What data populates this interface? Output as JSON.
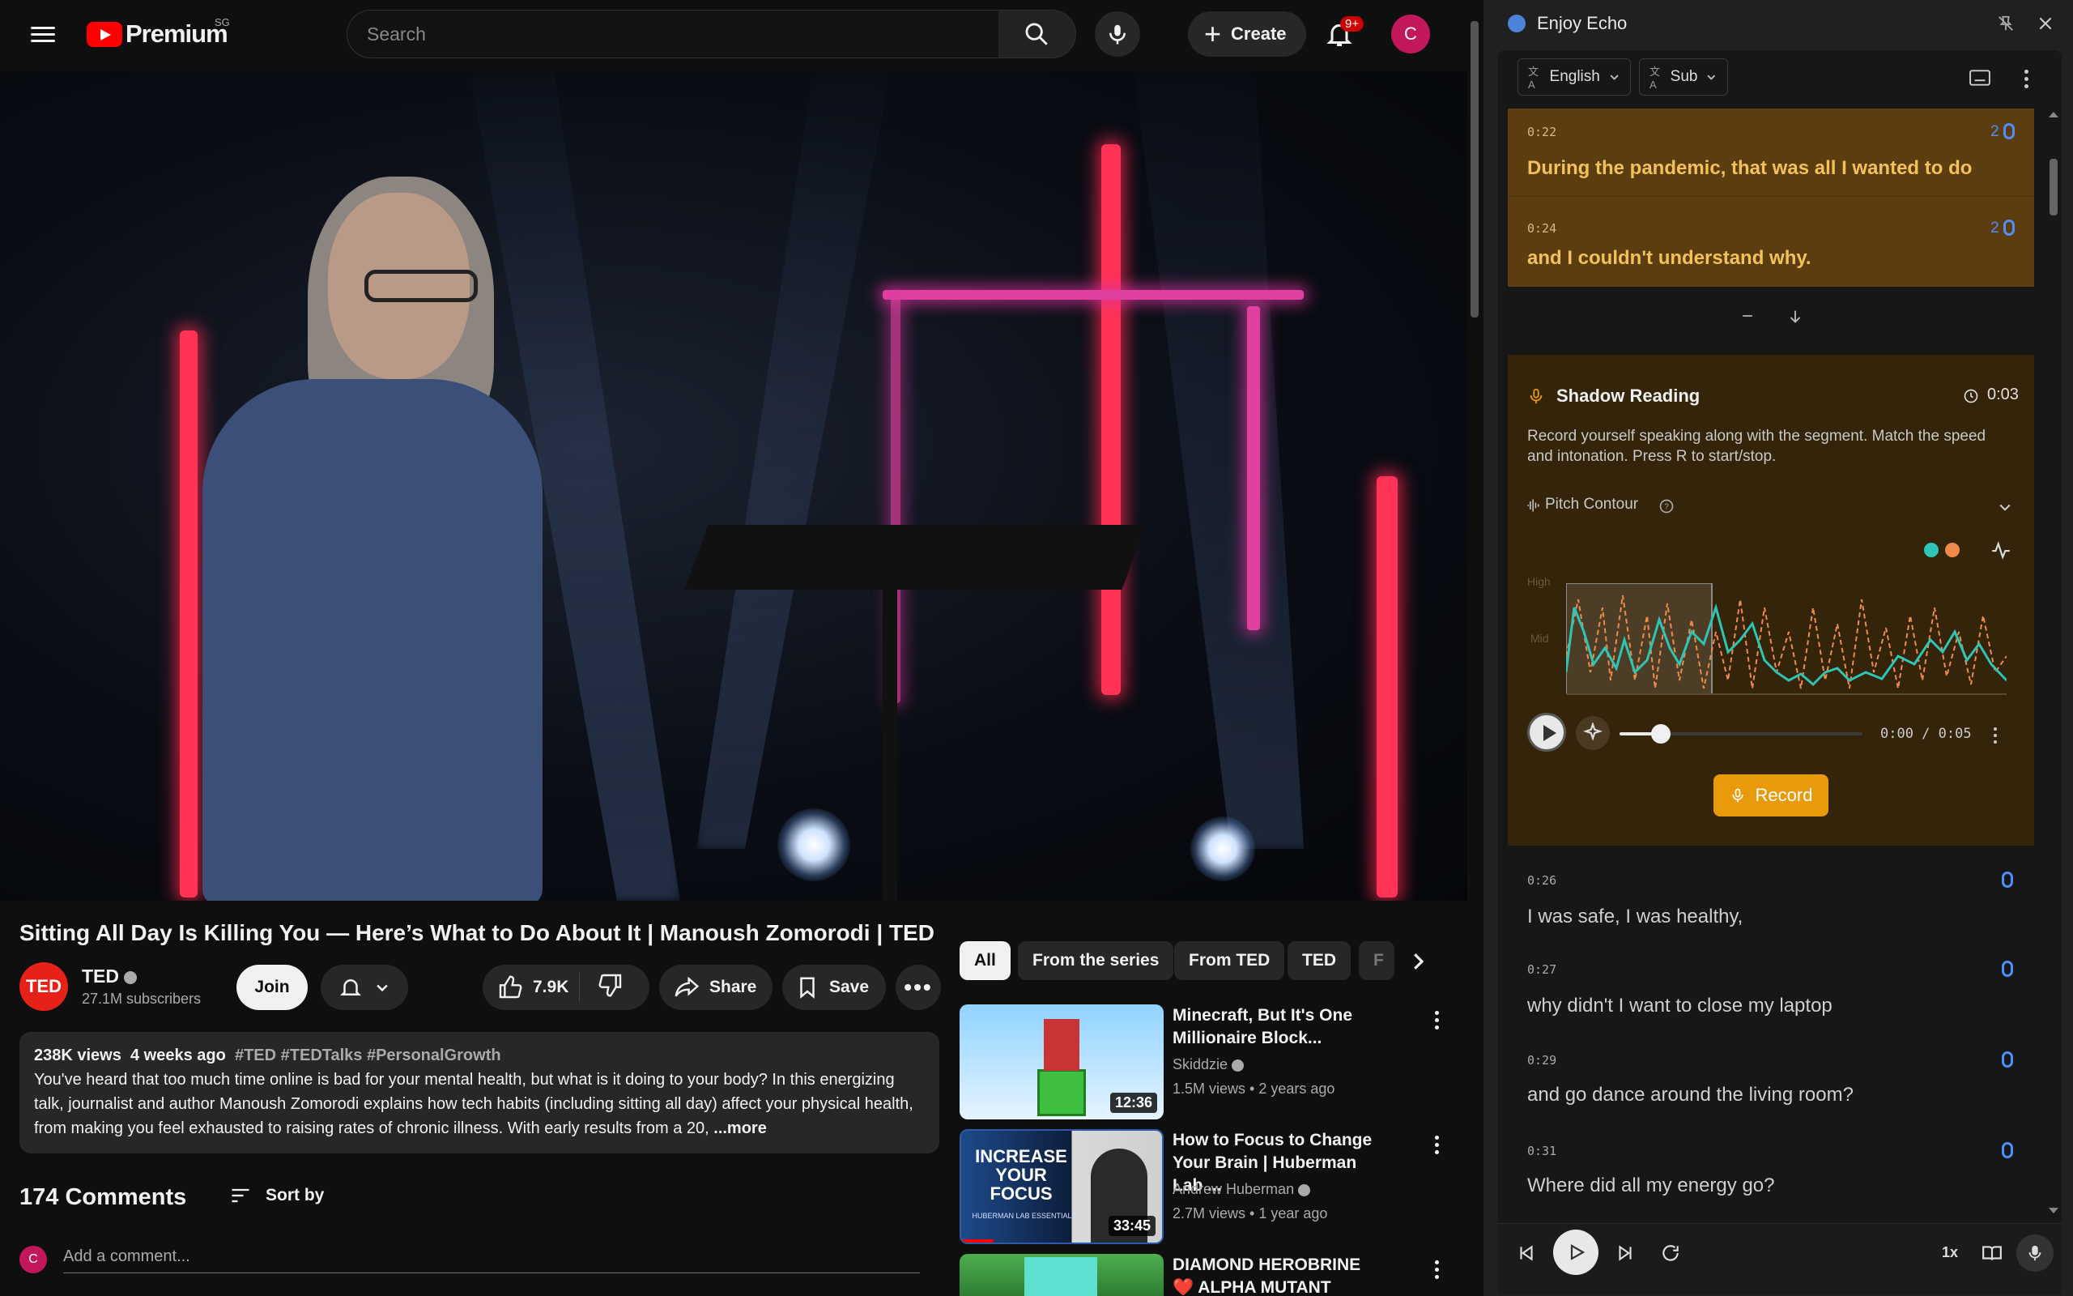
{
  "header": {
    "logo_text": "Premium",
    "region": "SG",
    "search_placeholder": "Search",
    "create_label": "Create",
    "notification_count": "9+",
    "avatar_letter": "C"
  },
  "video": {
    "title": "Sitting All Day Is Killing You — Here’s What to Do About It | Manoush Zomorodi | TED"
  },
  "channel": {
    "logo_text": "TED",
    "name": "TED",
    "subscribers": "27.1M subscribers",
    "join_label": "Join",
    "likes": "7.9K",
    "share_label": "Share",
    "save_label": "Save"
  },
  "description": {
    "views": "238K views",
    "age": "4 weeks ago",
    "tags": "#TED #TEDTalks #PersonalGrowth",
    "text": "You've heard that too much time online is bad for your mental health, but what is it doing to your body? In this energizing talk, journalist and author Manoush Zomorodi explains how tech habits (including sitting all day) affect your physical health, from making you feel exhausted to raising rates of chronic illness. With early results from a 20,",
    "more_label": "...more"
  },
  "comments": {
    "count_label": "174 Comments",
    "sort_label": "Sort by",
    "avatar_letter": "C",
    "add_placeholder": "Add a comment..."
  },
  "chips": [
    "All",
    "From the series",
    "From TED",
    "TED",
    "F"
  ],
  "recommendations": [
    {
      "title": "Minecraft, But It's One Millionaire Block...",
      "channel": "Skiddzie",
      "meta": "1.5M views • 2 years ago",
      "duration": "12:36"
    },
    {
      "title": "How to Focus to Change Your Brain | Huberman Lab ...",
      "channel": "Andrew Huberman",
      "meta": "2.7M views • 1 year ago",
      "duration": "33:45",
      "thumb_text": "INCREASE YOUR FOCUS",
      "thumb_sub": "HUBERMAN LAB ESSENTIALS"
    },
    {
      "title": "DIAMOND HEROBRINE ❤️ ALPHA MUTANT DIAMOND ...",
      "channel": "",
      "meta": "",
      "duration": ""
    }
  ],
  "echo": {
    "title": "Enjoy Echo",
    "language": "English",
    "subtitle_mode": "Sub",
    "segments_top": [
      {
        "time": "0:22",
        "text": "During the pandemic, that was all I wanted to do",
        "count": "2"
      },
      {
        "time": "0:24",
        "text": "and I couldn't understand why.",
        "count": "2"
      }
    ],
    "shadow": {
      "title": "Shadow Reading",
      "timer": "0:03",
      "description": "Record yourself speaking along with the segment. Match the speed and intonation. Press R to start/stop.",
      "pitch_label": "Pitch Contour",
      "axis_high": "High",
      "axis_mid": "Mid",
      "timecode": "0:00 / 0:05",
      "progress": 0.17,
      "record_label": "Record"
    },
    "segments_bottom": [
      {
        "time": "0:26",
        "text": "I was safe, I was healthy,"
      },
      {
        "time": "0:27",
        "text": "why didn't I want to close my laptop"
      },
      {
        "time": "0:29",
        "text": "and go dance around the living room?"
      },
      {
        "time": "0:31",
        "text": "Where did all my energy go?"
      }
    ],
    "speed": "1x",
    "colors": {
      "accent": "#e89a0a",
      "highlight": "#5c3d10",
      "mic": "#4f8ef7",
      "teal": "#2ec4b6",
      "orange": "#f08a4b"
    }
  }
}
